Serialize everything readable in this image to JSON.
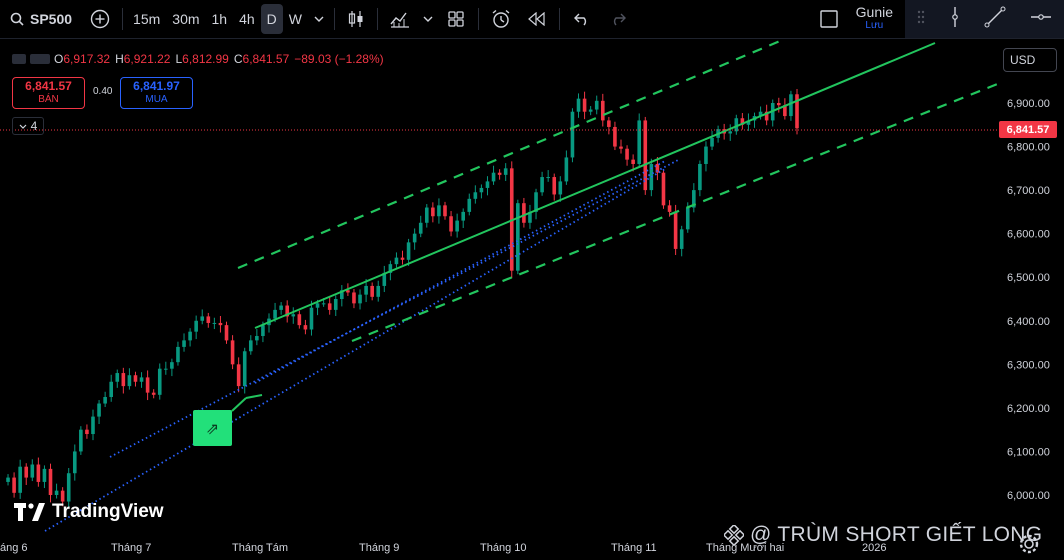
{
  "toolbar": {
    "symbol": "SP500",
    "timeframes": [
      "15m",
      "30m",
      "1h",
      "4h",
      "D",
      "W"
    ],
    "active_timeframe": "D",
    "user_name": "Gunie",
    "user_sub": "Lưu"
  },
  "legend": {
    "open_label": "O",
    "open": "6,917.32",
    "high_label": "H",
    "high": "6,921.22",
    "low_label": "L",
    "low": "6,812.99",
    "close_label": "C",
    "close": "6,841.57",
    "change": "−89.03 (−1.28%)"
  },
  "trade": {
    "sell_price": "6,841.57",
    "sell_label": "BÁN",
    "spread": "0.40",
    "buy_price": "6,841.97",
    "buy_label": "MUA",
    "lots": "4"
  },
  "price_axis": {
    "currency": "USD",
    "last_price": "6,841.57",
    "ticks": [
      "6,900.00",
      "6,800.00",
      "6,700.00",
      "6,600.00",
      "6,500.00",
      "6,400.00",
      "6,300.00",
      "6,200.00",
      "6,100.00",
      "6,000.00"
    ]
  },
  "time_axis": {
    "labels": [
      "áng 6",
      "Tháng 7",
      "Tháng Tám",
      "Tháng 9",
      "Tháng 10",
      "Tháng 11",
      "Tháng Mười hai",
      "2026"
    ]
  },
  "branding": {
    "logo_text": "TradingView",
    "watermark": "@ TRÙM SHORT GIẾT LONG"
  },
  "colors": {
    "up": "#089981",
    "down": "#f23645",
    "channel": "#22c55e",
    "dotted": "#2962ff",
    "accent": "#2962ff"
  },
  "chart_data": {
    "type": "candlestick",
    "symbol": "SP500",
    "ylim": [
      5960,
      6990
    ],
    "y_ticks": [
      6900,
      6800,
      6700,
      6600,
      6500,
      6400,
      6300,
      6200,
      6100,
      6000
    ],
    "last_price": 6841.57,
    "x_labels": [
      "áng 6",
      "Tháng 7",
      "Tháng Tám",
      "Tháng 9",
      "Tháng 10",
      "Tháng 11",
      "Tháng Mười hai",
      "2026"
    ],
    "closes": [
      6040,
      6005,
      6065,
      6040,
      6070,
      6030,
      6060,
      6000,
      6010,
      5985,
      6050,
      6100,
      6150,
      6140,
      6180,
      6210,
      6225,
      6260,
      6280,
      6250,
      6275,
      6260,
      6270,
      6235,
      6230,
      6290,
      6290,
      6305,
      6340,
      6355,
      6375,
      6400,
      6410,
      6395,
      6395,
      6390,
      6355,
      6300,
      6250,
      6330,
      6355,
      6365,
      6390,
      6405,
      6425,
      6435,
      6410,
      6415,
      6390,
      6380,
      6430,
      6440,
      6440,
      6425,
      6450,
      6470,
      6465,
      6440,
      6460,
      6480,
      6455,
      6480,
      6510,
      6530,
      6545,
      6540,
      6580,
      6600,
      6625,
      6660,
      6640,
      6665,
      6640,
      6605,
      6630,
      6650,
      6680,
      6695,
      6705,
      6720,
      6740,
      6735,
      6750,
      6515,
      6670,
      6625,
      6650,
      6695,
      6730,
      6730,
      6690,
      6720,
      6775,
      6880,
      6910,
      6880,
      6885,
      6905,
      6860,
      6845,
      6800,
      6795,
      6770,
      6760,
      6860,
      6700,
      6760,
      6740,
      6665,
      6650,
      6565,
      6610,
      6660,
      6700,
      6760,
      6800,
      6820,
      6840,
      6830,
      6835,
      6865,
      6850,
      6860,
      6870,
      6880,
      6860,
      6900,
      6895,
      6870,
      6920,
      6842
    ]
  }
}
